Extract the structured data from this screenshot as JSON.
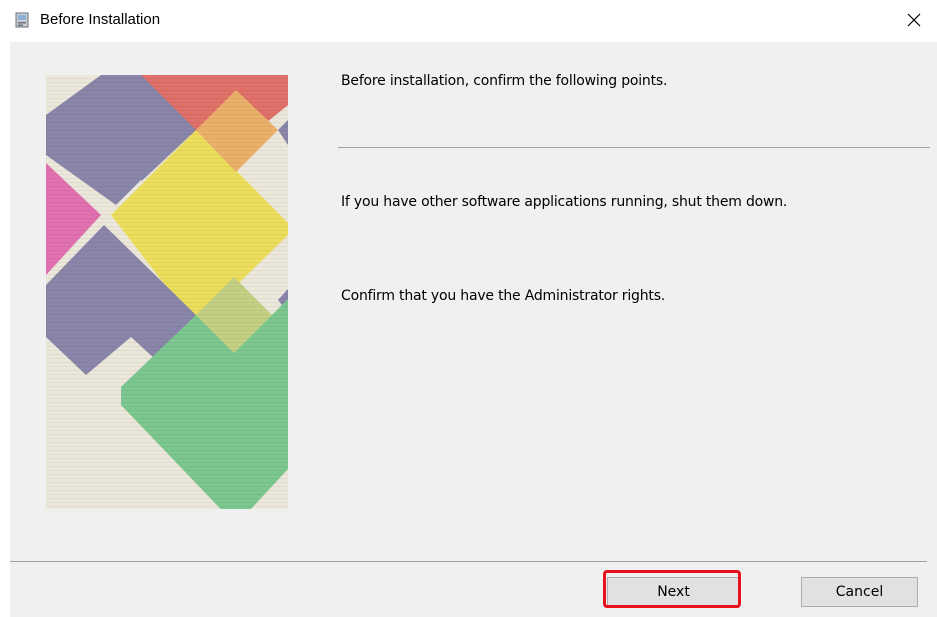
{
  "window": {
    "title": "Before Installation",
    "close_glyph": "×"
  },
  "content": {
    "heading": "Before installation, confirm the following points.",
    "point_1": "If you have other software applications running, shut them down.",
    "point_2": "Confirm that you have the Administrator rights."
  },
  "buttons": {
    "next_label": "Next",
    "cancel_label": "Cancel"
  },
  "colors": {
    "dialog_background": "#f0f0f0",
    "highlight": "#e8101d",
    "art_purple": "#8a86aa",
    "art_red": "#e0706a",
    "art_yellow": "#ecde5c",
    "art_pink": "#e070b0",
    "art_green": "#7cc690",
    "art_orange": "#e9b06a"
  },
  "icons": {
    "app": "installer-icon",
    "close": "close-icon"
  }
}
